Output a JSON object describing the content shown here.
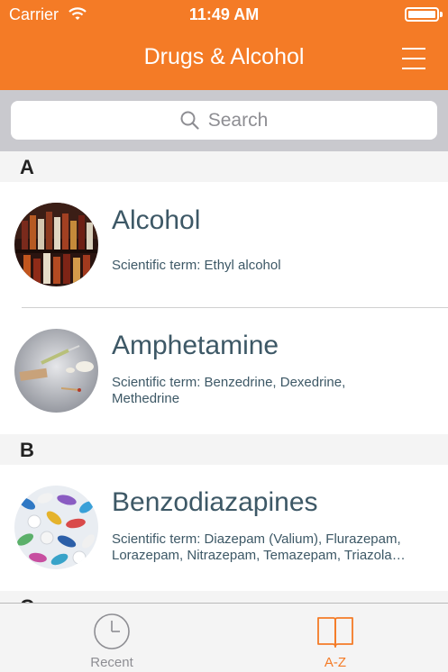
{
  "status": {
    "carrier": "Carrier",
    "time": "11:49 AM"
  },
  "nav": {
    "title": "Drugs & Alcohol"
  },
  "search": {
    "placeholder": "Search"
  },
  "sections": [
    {
      "letter": "A"
    },
    {
      "letter": "B"
    },
    {
      "letter": "C"
    }
  ],
  "items": [
    {
      "title": "Alcohol",
      "subtitle": "Scientific term: Ethyl alcohol"
    },
    {
      "title": "Amphetamine",
      "subtitle_line1": "Scientific term: Benzedrine, Dexedrine,",
      "subtitle_line2": "Methedrine"
    },
    {
      "title": "Benzodiazapines",
      "subtitle_line1": "Scientific term: Diazepam (Valium), Flurazepam,",
      "subtitle_line2": "Lorazepam, Nitrazepam, Temazepam, Triazola…"
    }
  ],
  "tabs": [
    {
      "label": "Recent",
      "icon": "clock-icon",
      "active": false
    },
    {
      "label": "A-Z",
      "icon": "book-icon",
      "active": true
    }
  ],
  "colors": {
    "accent": "#f47b26",
    "text": "#3d5866",
    "inactive": "#8e8e93"
  }
}
